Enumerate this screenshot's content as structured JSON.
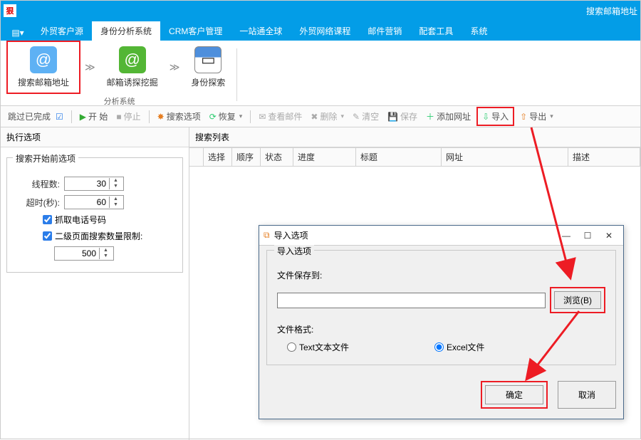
{
  "title_right": "搜索邮箱地址",
  "logo_text": "狠",
  "tabs": {
    "t0": "外贸客户源",
    "t1": "身份分析系统",
    "t2": "CRM客户管理",
    "t3": "一站通全球",
    "t4": "外贸网络课程",
    "t5": "邮件营销",
    "t6": "配套工具",
    "t7": "系统"
  },
  "ribbon": {
    "btn0": "搜索邮箱地址",
    "btn1": "邮箱诱探挖掘",
    "btn2": "身份探索",
    "group": "分析系统"
  },
  "toolbar": {
    "skip": "跳过已完成",
    "start": "开 始",
    "stop": "停止",
    "opts": "搜索选项",
    "restore": "恢复",
    "view": "查看邮件",
    "del": "删除",
    "clear": "清空",
    "save": "保存",
    "addurl": "添加网址",
    "import": "导入",
    "export": "导出"
  },
  "left": {
    "header": "执行选项",
    "legend": "搜索开始前选项",
    "threads_label": "线程数:",
    "threads_val": "30",
    "timeout_label": "超时(秒):",
    "timeout_val": "60",
    "chk1": "抓取电话号码",
    "chk2": "二级页面搜索数量限制:",
    "limit_val": "500"
  },
  "right_header": "搜索列表",
  "cols": {
    "c0": "选择",
    "c1": "顺序",
    "c2": "状态",
    "c3": "进度",
    "c4": "标题",
    "c5": "网址",
    "c6": "描述"
  },
  "dialog": {
    "title": "导入选项",
    "legend": "导入选项",
    "path_label": "文件保存到:",
    "path_val": "",
    "browse": "浏览(B)",
    "format_label": "文件格式:",
    "r1": "Text文本文件",
    "r2": "Excel文件",
    "ok": "确定",
    "cancel": "取消"
  }
}
